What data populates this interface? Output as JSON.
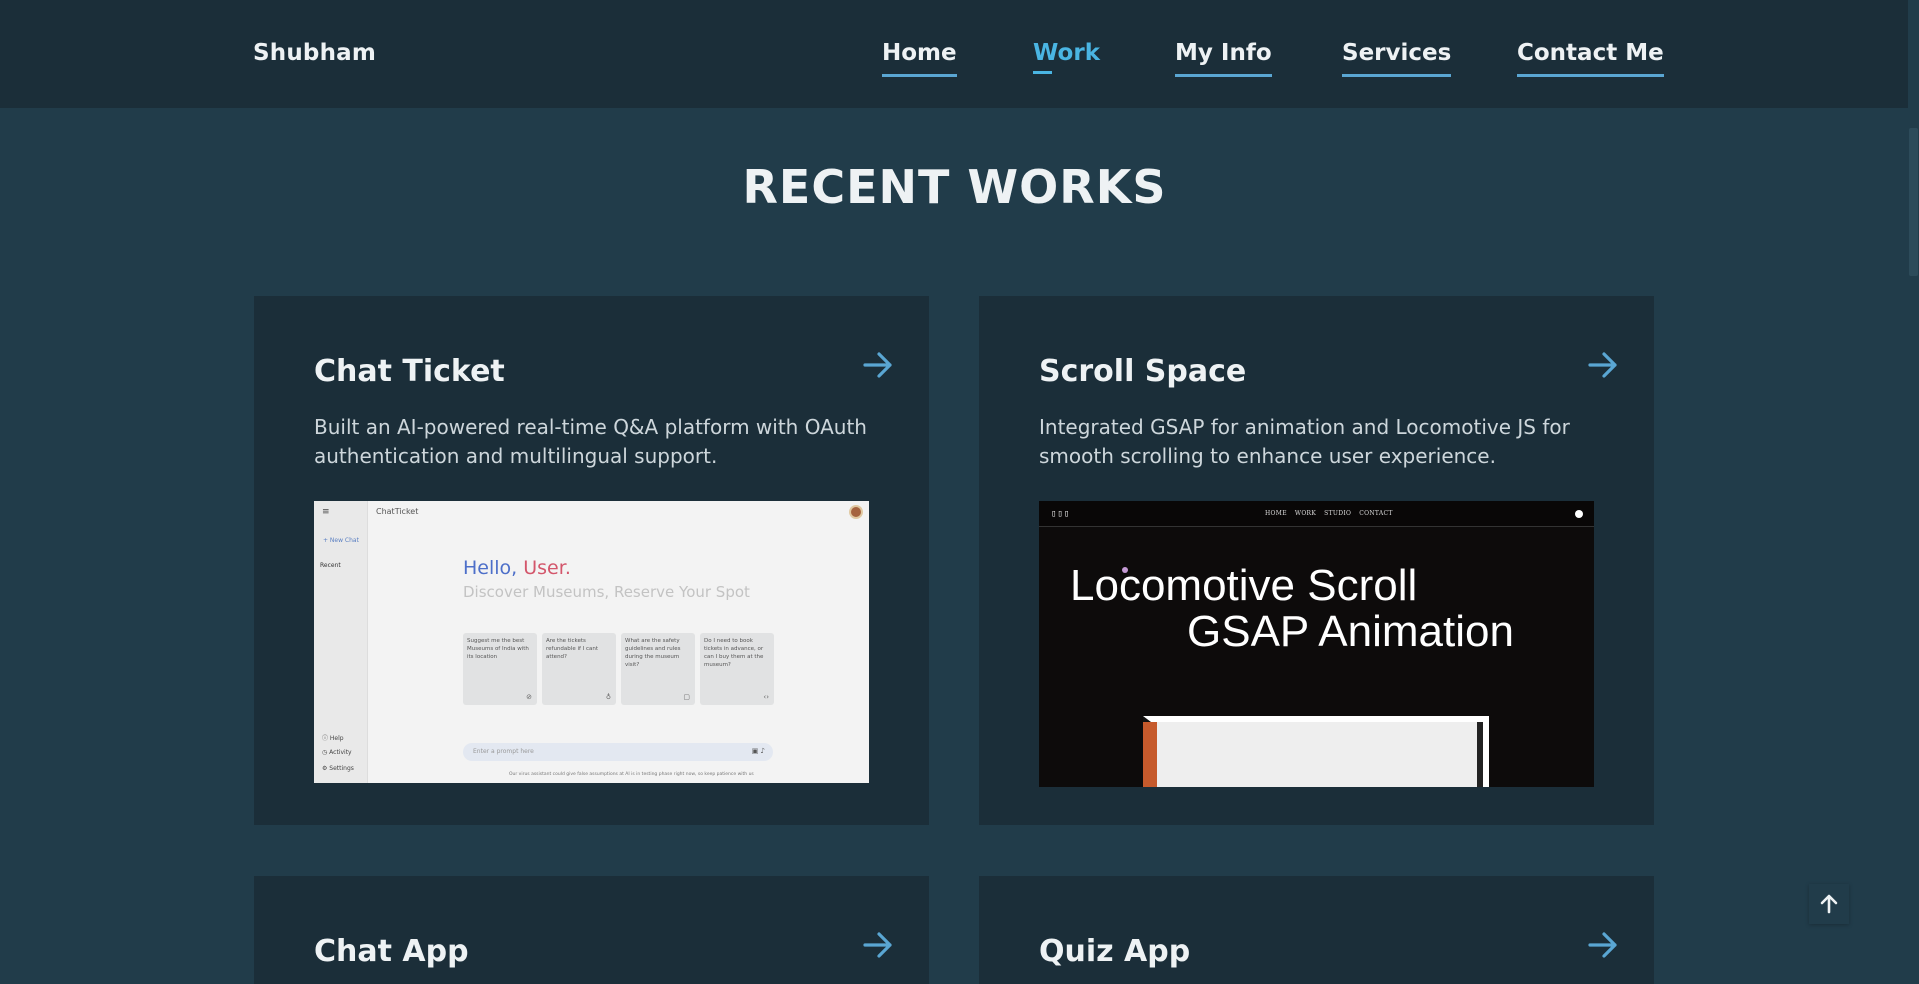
{
  "header": {
    "brand": "Shubham",
    "nav": [
      {
        "label": "Home",
        "active": false
      },
      {
        "label": "Work",
        "active": true
      },
      {
        "label": "My Info",
        "active": false
      },
      {
        "label": "Services",
        "active": false
      },
      {
        "label": "Contact Me",
        "active": false
      }
    ]
  },
  "section": {
    "title": "RECENT WORKS"
  },
  "cards": [
    {
      "title": "Chat Ticket",
      "description": "Built an AI-powered real-time Q&A platform with OAuth authentication and multilingual support.",
      "preview": {
        "app_name": "ChatTicket",
        "new_chat": "+ New Chat",
        "recent": "Recent",
        "sidebar_bottom": [
          "Help",
          "Activity",
          "Settings"
        ],
        "hello_1": "Hello,",
        "hello_2": "User.",
        "subtitle": "Discover Museums, Reserve Your Spot",
        "suggestions": [
          "Suggest me the best Museums of India with its location",
          "Are the tickets refundable if I cant attend?",
          "What are the safety guidelines and rules during the museum visit?",
          "Do I need to book tickets in advance, or can I buy them at the museum?"
        ],
        "prompt_placeholder": "Enter a prompt here",
        "footer_note": "Our virus assistant could give false assumptions at AI is in testing phase right now, so keep patience with us"
      }
    },
    {
      "title": "Scroll Space",
      "description": "Integrated GSAP for animation and Locomotive JS for smooth scrolling to enhance user experience.",
      "preview": {
        "logo": "▯▯▯",
        "nav": [
          "HOME",
          "WORK",
          "STUDIO",
          "CONTACT"
        ],
        "line1": "Locomotive Scroll",
        "line2": "GSAP Animation"
      }
    },
    {
      "title": "Chat App"
    },
    {
      "title": "Quiz App"
    }
  ],
  "colors": {
    "page_bg": "#213c4a",
    "header_bg": "#1b2e39",
    "card_bg": "#1b2e39",
    "accent": "#4ab5e3",
    "arrow": "#5aa6d3"
  }
}
